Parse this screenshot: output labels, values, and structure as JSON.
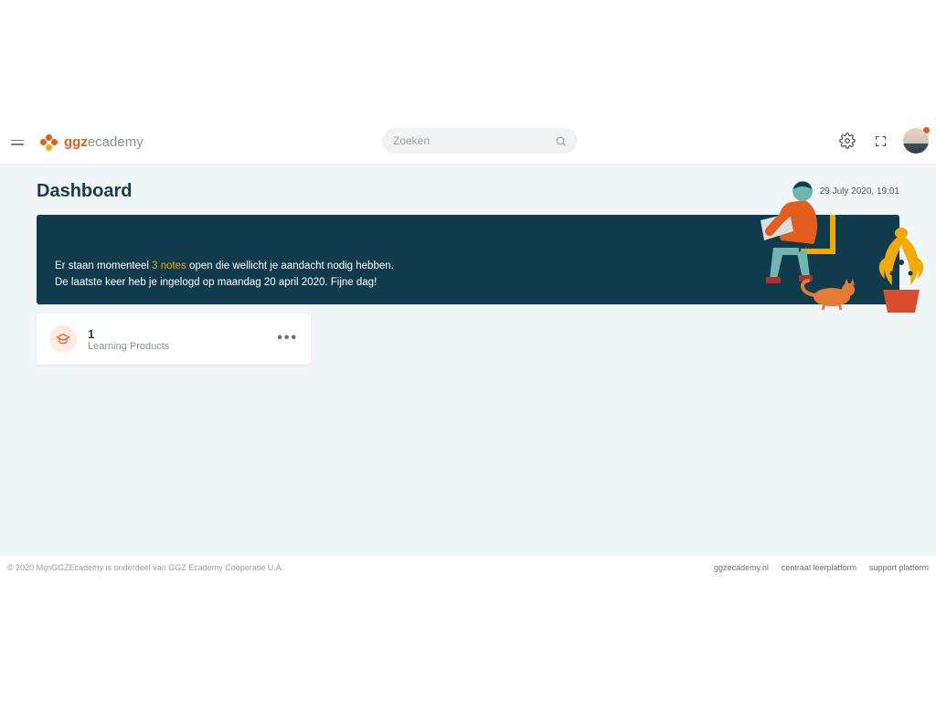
{
  "header": {
    "logo": {
      "part1": "ggz",
      "part2": "ecademy"
    },
    "search_placeholder": "Zoeken"
  },
  "page": {
    "title": "Dashboard",
    "timestamp": "29 July 2020, 19:01"
  },
  "banner": {
    "line1_pre": "Er staan momenteel ",
    "notes_text": "3 notes",
    "line1_post": " open die wellicht je aandacht nodig hebben.",
    "line2": "De laatste keer heb je ingelogd op maandag 20 april 2020. Fijne dag!"
  },
  "card": {
    "count": "1",
    "label": "Learning Products"
  },
  "footer": {
    "copyright": "© 2020 MijnGGZEcademy is onderdeel van GGZ Ecademy Coöperatie U.A.",
    "links": [
      "ggzecademy.nl",
      "centraal leerplatform",
      "support platform"
    ]
  }
}
